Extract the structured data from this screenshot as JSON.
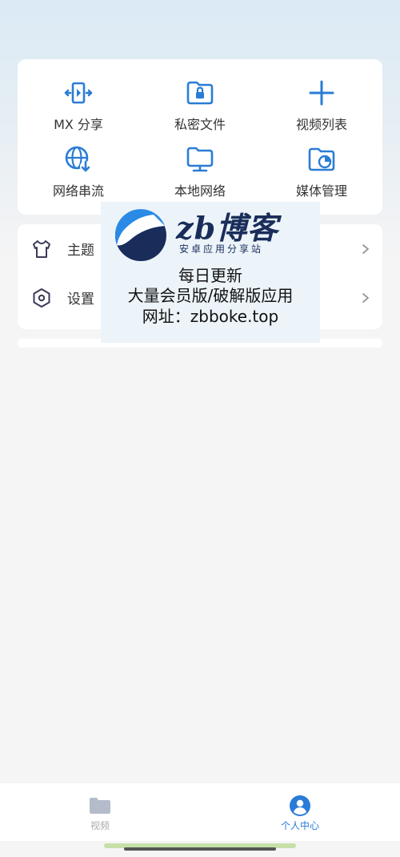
{
  "grid": [
    {
      "label": "MX 分享",
      "icon": "mx-share-icon"
    },
    {
      "label": "私密文件",
      "icon": "private-folder-icon"
    },
    {
      "label": "视频列表",
      "icon": "plus-icon"
    },
    {
      "label": "网络串流",
      "icon": "network-stream-icon"
    },
    {
      "label": "本地网络",
      "icon": "local-network-icon"
    },
    {
      "label": "媒体管理",
      "icon": "media-manage-icon"
    }
  ],
  "menu": [
    {
      "label": "主题",
      "icon": "tshirt-icon"
    },
    {
      "label": "设置",
      "icon": "settings-icon"
    }
  ],
  "watermark": {
    "title": "zb博客",
    "subtitle": "安卓应用分享站",
    "line1": "每日更新",
    "line2": "大量会员版/破解版应用",
    "line3": "网址：zbboke.top"
  },
  "nav": {
    "video_label": "视频",
    "me_label": "个人中心"
  },
  "colors": {
    "accent": "#2a7cd6",
    "inactive": "#aaaaaa",
    "background": "#f5f5f5"
  }
}
